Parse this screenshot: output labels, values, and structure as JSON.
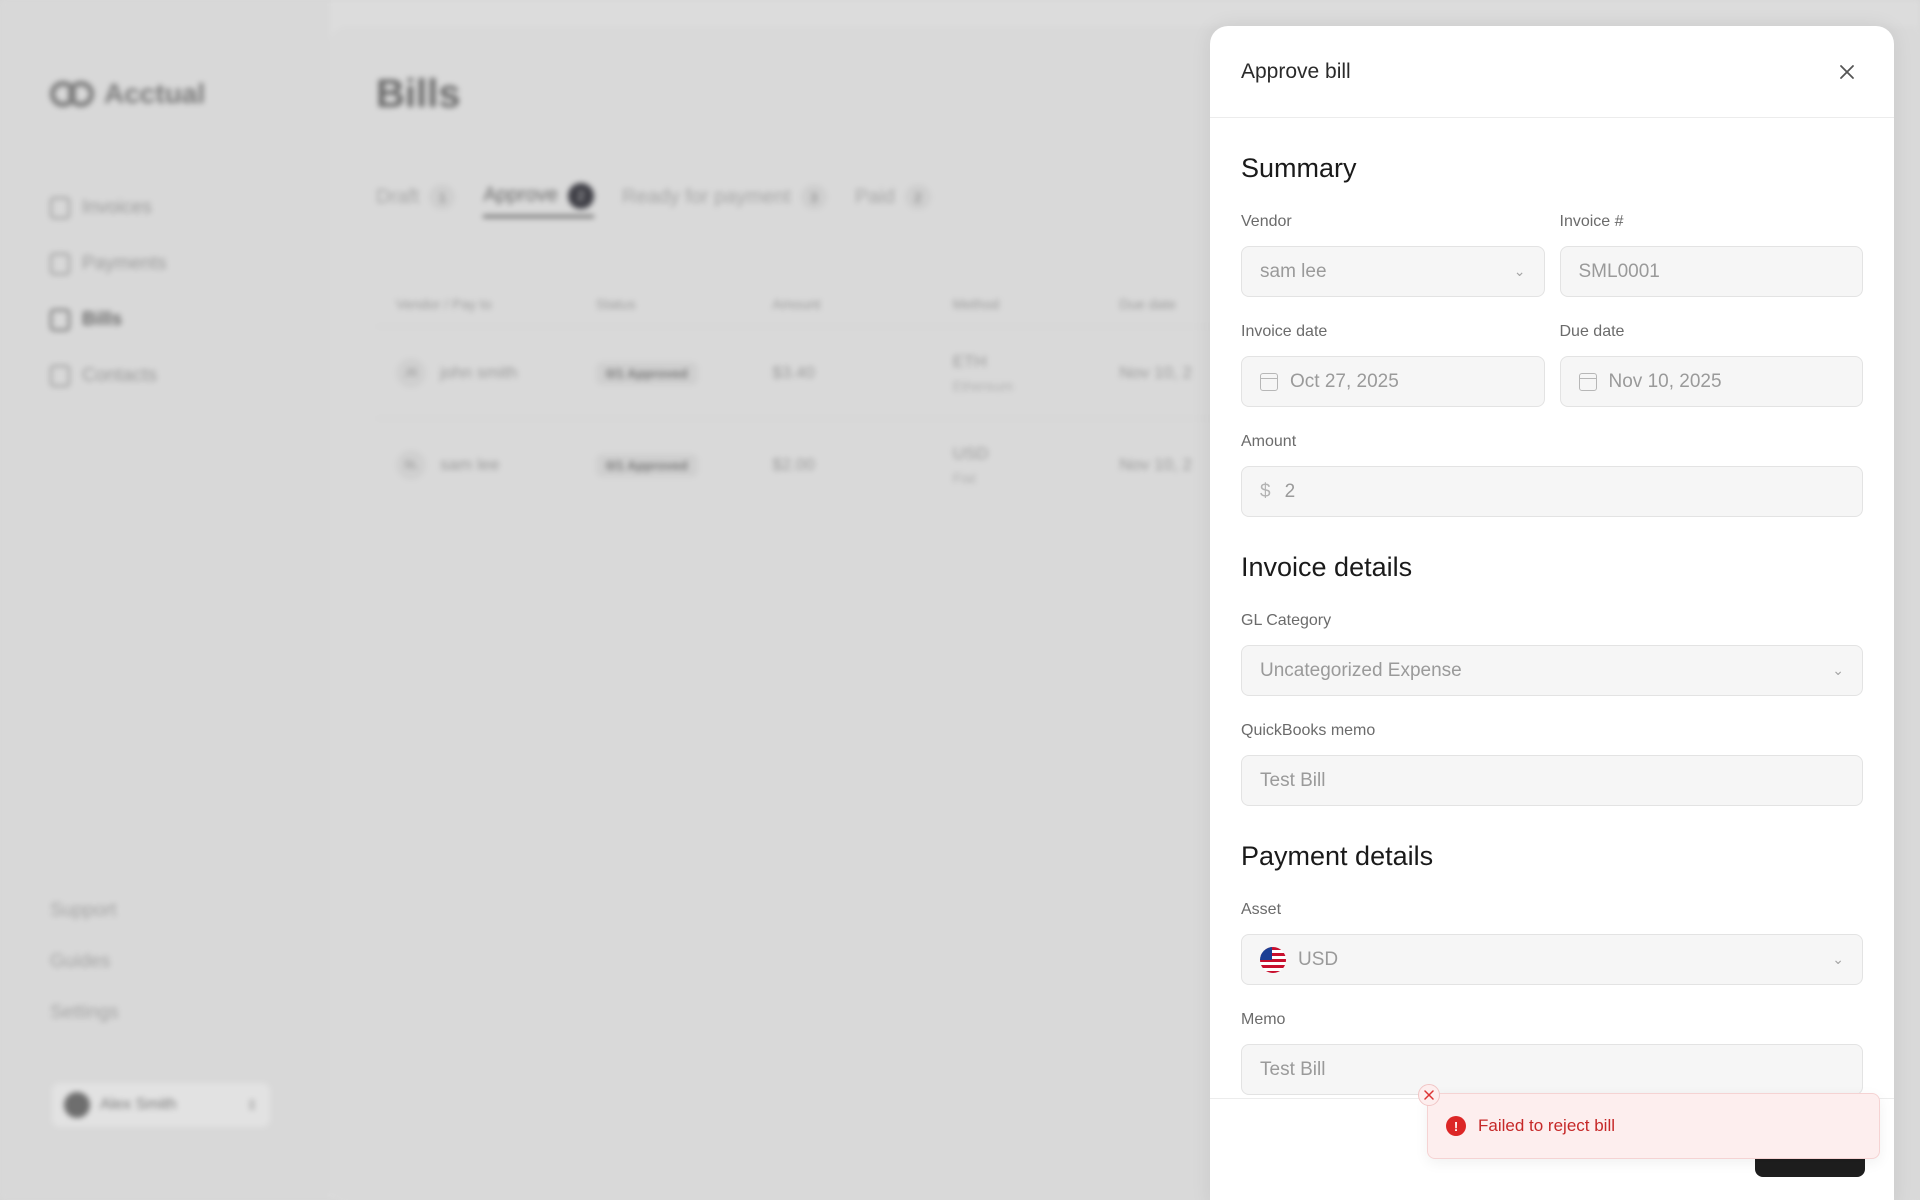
{
  "background": {
    "logo": "Acctual",
    "nav": [
      "Invoices",
      "Payments",
      "Bills",
      "Contacts"
    ],
    "active_nav": "Bills",
    "bottom_nav": [
      "Support",
      "Guides",
      "Settings"
    ],
    "user_name": "Alex Smith",
    "page_title": "Bills",
    "tabs": [
      {
        "label": "Draft",
        "count": "1"
      },
      {
        "label": "Approve",
        "count": "2"
      },
      {
        "label": "Ready for payment",
        "count": "3"
      },
      {
        "label": "Paid",
        "count": "2"
      }
    ],
    "columns": [
      "Vendor / Pay to",
      "Status",
      "Amount",
      "Method",
      "Due date"
    ],
    "rows": [
      {
        "avatar": "JS",
        "vendor": "john smith",
        "status": "0/1 Approved",
        "amount": "$3.40",
        "method": "ETH",
        "method_sub": "Ethereum",
        "due": "Nov 10, 2"
      },
      {
        "avatar": "SL",
        "vendor": "sam lee",
        "status": "0/1 Approved",
        "amount": "$2.00",
        "method": "USD",
        "method_sub": "Fiat",
        "due": "Nov 10, 2"
      }
    ]
  },
  "drawer": {
    "title": "Approve bill",
    "summary": {
      "heading": "Summary",
      "vendor_label": "Vendor",
      "vendor_value": "sam lee",
      "invoice_no_label": "Invoice #",
      "invoice_no_value": "SML0001",
      "invoice_date_label": "Invoice date",
      "invoice_date_value": "Oct 27, 2025",
      "due_date_label": "Due date",
      "due_date_value": "Nov 10, 2025",
      "amount_label": "Amount",
      "amount_currency": "$",
      "amount_value": "2"
    },
    "invoice_details": {
      "heading": "Invoice details",
      "gl_label": "GL Category",
      "gl_value": "Uncategorized Expense",
      "qb_memo_label": "QuickBooks memo",
      "qb_memo_value": "Test Bill"
    },
    "payment_details": {
      "heading": "Payment details",
      "asset_label": "Asset",
      "asset_value": "USD",
      "memo_label": "Memo",
      "memo_value": "Test Bill"
    }
  },
  "toast": {
    "message": "Failed to reject bill",
    "color": "#dc2626"
  }
}
